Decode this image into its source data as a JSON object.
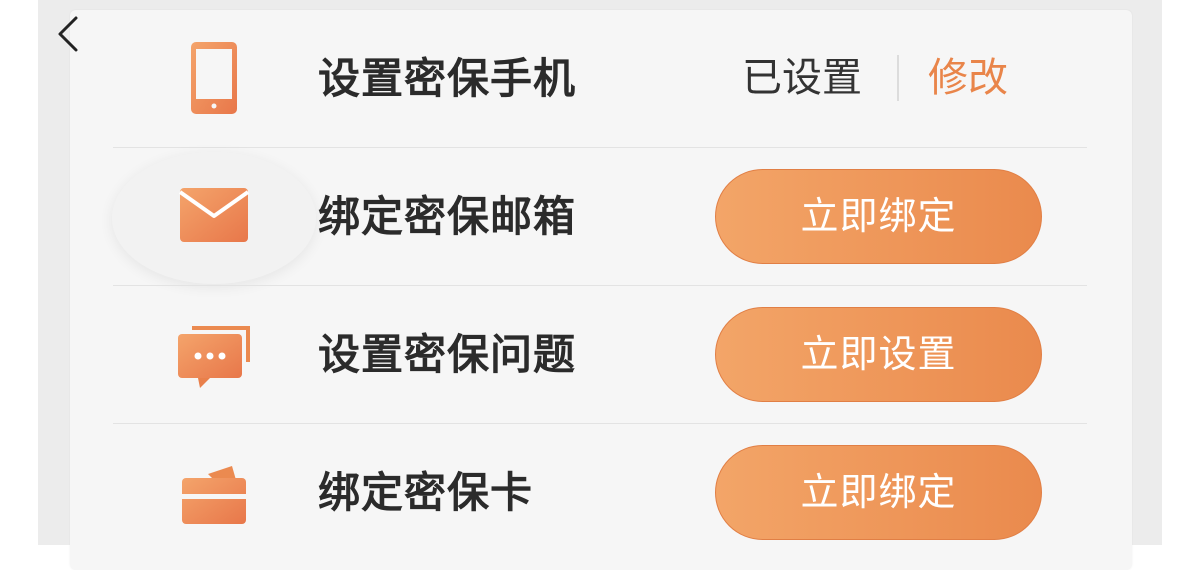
{
  "colors": {
    "accent": "#e9854a",
    "button_gradient_start": "#f3a568",
    "button_gradient_end": "#ea8a4d",
    "title_text": "#2b2b2b",
    "card_background": "#f6f6f6"
  },
  "header": {
    "back_icon": "chevron-left-icon"
  },
  "rows": [
    {
      "icon": "phone-icon",
      "title": "设置密保手机",
      "status": "已设置",
      "action": "修改"
    },
    {
      "icon": "mail-icon",
      "title": "绑定密保邮箱",
      "action": "立即绑定"
    },
    {
      "icon": "chat-bubble-icon",
      "title": "设置密保问题",
      "action": "立即设置"
    },
    {
      "icon": "card-icon",
      "title": "绑定密保卡",
      "action": "立即绑定"
    }
  ]
}
